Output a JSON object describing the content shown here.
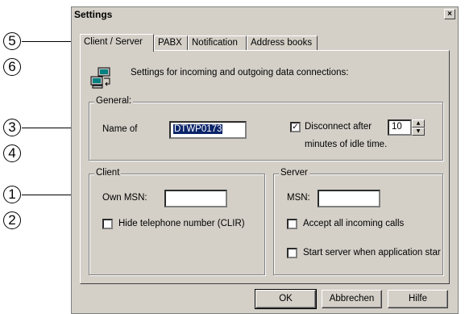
{
  "window": {
    "title": "Settings",
    "close_symbol": "×"
  },
  "callouts": [
    "5",
    "6",
    "3",
    "4",
    "1",
    "2"
  ],
  "tabs": [
    {
      "label": "Client / Server",
      "active": true
    },
    {
      "label": "PABX",
      "active": false
    },
    {
      "label": "Notification",
      "active": false
    },
    {
      "label": "Address books",
      "active": false
    }
  ],
  "intro": {
    "icon": "network-computers-icon",
    "text": "Settings for incoming and outgoing data connections:"
  },
  "general": {
    "label": "General:",
    "name_label": "Name of",
    "name_value": "DTWP0173",
    "disconnect_label": "Disconnect after",
    "disconnect_checked": true,
    "disconnect_minutes": "10",
    "idle_text": "minutes of idle time."
  },
  "client": {
    "label": "Client",
    "own_msn_label": "Own MSN:",
    "own_msn_value": "",
    "hide_number_label": "Hide telephone number (CLIR)",
    "hide_number_checked": false
  },
  "server": {
    "label": "Server",
    "msn_label": "MSN:",
    "msn_value": "",
    "accept_all_label": "Accept all incoming calls",
    "accept_all_checked": false,
    "start_server_label": "Start server when application star",
    "start_server_checked": false
  },
  "buttons": {
    "ok": "OK",
    "cancel": "Abbrechen",
    "help": "Hilfe"
  },
  "check_mark": "✓"
}
